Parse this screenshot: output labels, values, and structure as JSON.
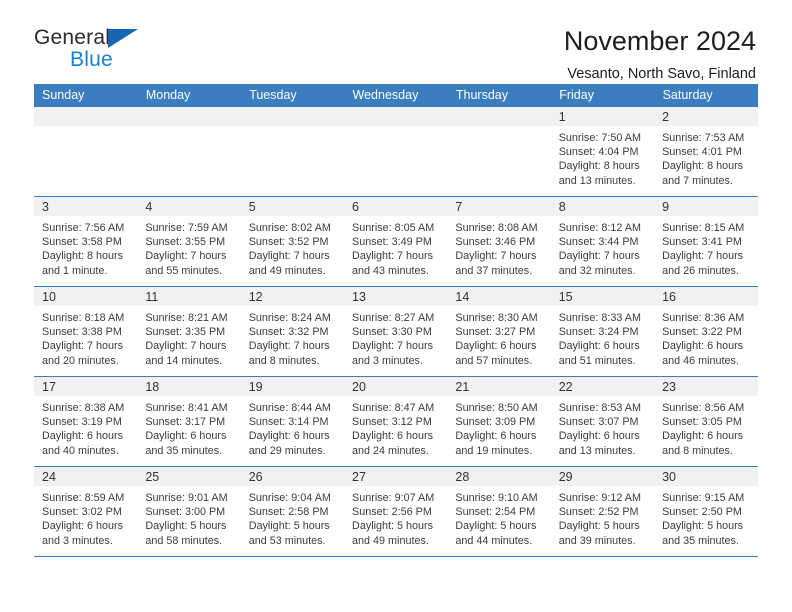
{
  "brand": {
    "word_one": "General",
    "word_two": "Blue",
    "triangle_icon": "triangle-icon",
    "accent_color": "#1667b2",
    "blue_color": "#1a7ed1"
  },
  "header": {
    "title": "November 2024",
    "subtitle": "Vesanto, North Savo, Finland"
  },
  "theme": {
    "header_blue": "#3a7ec0",
    "daynum_band": "#f1f1f1",
    "text": "#3c3c3c"
  },
  "weekdays": [
    "Sunday",
    "Monday",
    "Tuesday",
    "Wednesday",
    "Thursday",
    "Friday",
    "Saturday"
  ],
  "weeks": [
    [
      {
        "day": "",
        "sunrise": "",
        "sunset": "",
        "daylight_1": "",
        "daylight_2": ""
      },
      {
        "day": "",
        "sunrise": "",
        "sunset": "",
        "daylight_1": "",
        "daylight_2": ""
      },
      {
        "day": "",
        "sunrise": "",
        "sunset": "",
        "daylight_1": "",
        "daylight_2": ""
      },
      {
        "day": "",
        "sunrise": "",
        "sunset": "",
        "daylight_1": "",
        "daylight_2": ""
      },
      {
        "day": "",
        "sunrise": "",
        "sunset": "",
        "daylight_1": "",
        "daylight_2": ""
      },
      {
        "day": "1",
        "sunrise": "Sunrise: 7:50 AM",
        "sunset": "Sunset: 4:04 PM",
        "daylight_1": "Daylight: 8 hours",
        "daylight_2": "and 13 minutes."
      },
      {
        "day": "2",
        "sunrise": "Sunrise: 7:53 AM",
        "sunset": "Sunset: 4:01 PM",
        "daylight_1": "Daylight: 8 hours",
        "daylight_2": "and 7 minutes."
      }
    ],
    [
      {
        "day": "3",
        "sunrise": "Sunrise: 7:56 AM",
        "sunset": "Sunset: 3:58 PM",
        "daylight_1": "Daylight: 8 hours",
        "daylight_2": "and 1 minute."
      },
      {
        "day": "4",
        "sunrise": "Sunrise: 7:59 AM",
        "sunset": "Sunset: 3:55 PM",
        "daylight_1": "Daylight: 7 hours",
        "daylight_2": "and 55 minutes."
      },
      {
        "day": "5",
        "sunrise": "Sunrise: 8:02 AM",
        "sunset": "Sunset: 3:52 PM",
        "daylight_1": "Daylight: 7 hours",
        "daylight_2": "and 49 minutes."
      },
      {
        "day": "6",
        "sunrise": "Sunrise: 8:05 AM",
        "sunset": "Sunset: 3:49 PM",
        "daylight_1": "Daylight: 7 hours",
        "daylight_2": "and 43 minutes."
      },
      {
        "day": "7",
        "sunrise": "Sunrise: 8:08 AM",
        "sunset": "Sunset: 3:46 PM",
        "daylight_1": "Daylight: 7 hours",
        "daylight_2": "and 37 minutes."
      },
      {
        "day": "8",
        "sunrise": "Sunrise: 8:12 AM",
        "sunset": "Sunset: 3:44 PM",
        "daylight_1": "Daylight: 7 hours",
        "daylight_2": "and 32 minutes."
      },
      {
        "day": "9",
        "sunrise": "Sunrise: 8:15 AM",
        "sunset": "Sunset: 3:41 PM",
        "daylight_1": "Daylight: 7 hours",
        "daylight_2": "and 26 minutes."
      }
    ],
    [
      {
        "day": "10",
        "sunrise": "Sunrise: 8:18 AM",
        "sunset": "Sunset: 3:38 PM",
        "daylight_1": "Daylight: 7 hours",
        "daylight_2": "and 20 minutes."
      },
      {
        "day": "11",
        "sunrise": "Sunrise: 8:21 AM",
        "sunset": "Sunset: 3:35 PM",
        "daylight_1": "Daylight: 7 hours",
        "daylight_2": "and 14 minutes."
      },
      {
        "day": "12",
        "sunrise": "Sunrise: 8:24 AM",
        "sunset": "Sunset: 3:32 PM",
        "daylight_1": "Daylight: 7 hours",
        "daylight_2": "and 8 minutes."
      },
      {
        "day": "13",
        "sunrise": "Sunrise: 8:27 AM",
        "sunset": "Sunset: 3:30 PM",
        "daylight_1": "Daylight: 7 hours",
        "daylight_2": "and 3 minutes."
      },
      {
        "day": "14",
        "sunrise": "Sunrise: 8:30 AM",
        "sunset": "Sunset: 3:27 PM",
        "daylight_1": "Daylight: 6 hours",
        "daylight_2": "and 57 minutes."
      },
      {
        "day": "15",
        "sunrise": "Sunrise: 8:33 AM",
        "sunset": "Sunset: 3:24 PM",
        "daylight_1": "Daylight: 6 hours",
        "daylight_2": "and 51 minutes."
      },
      {
        "day": "16",
        "sunrise": "Sunrise: 8:36 AM",
        "sunset": "Sunset: 3:22 PM",
        "daylight_1": "Daylight: 6 hours",
        "daylight_2": "and 46 minutes."
      }
    ],
    [
      {
        "day": "17",
        "sunrise": "Sunrise: 8:38 AM",
        "sunset": "Sunset: 3:19 PM",
        "daylight_1": "Daylight: 6 hours",
        "daylight_2": "and 40 minutes."
      },
      {
        "day": "18",
        "sunrise": "Sunrise: 8:41 AM",
        "sunset": "Sunset: 3:17 PM",
        "daylight_1": "Daylight: 6 hours",
        "daylight_2": "and 35 minutes."
      },
      {
        "day": "19",
        "sunrise": "Sunrise: 8:44 AM",
        "sunset": "Sunset: 3:14 PM",
        "daylight_1": "Daylight: 6 hours",
        "daylight_2": "and 29 minutes."
      },
      {
        "day": "20",
        "sunrise": "Sunrise: 8:47 AM",
        "sunset": "Sunset: 3:12 PM",
        "daylight_1": "Daylight: 6 hours",
        "daylight_2": "and 24 minutes."
      },
      {
        "day": "21",
        "sunrise": "Sunrise: 8:50 AM",
        "sunset": "Sunset: 3:09 PM",
        "daylight_1": "Daylight: 6 hours",
        "daylight_2": "and 19 minutes."
      },
      {
        "day": "22",
        "sunrise": "Sunrise: 8:53 AM",
        "sunset": "Sunset: 3:07 PM",
        "daylight_1": "Daylight: 6 hours",
        "daylight_2": "and 13 minutes."
      },
      {
        "day": "23",
        "sunrise": "Sunrise: 8:56 AM",
        "sunset": "Sunset: 3:05 PM",
        "daylight_1": "Daylight: 6 hours",
        "daylight_2": "and 8 minutes."
      }
    ],
    [
      {
        "day": "24",
        "sunrise": "Sunrise: 8:59 AM",
        "sunset": "Sunset: 3:02 PM",
        "daylight_1": "Daylight: 6 hours",
        "daylight_2": "and 3 minutes."
      },
      {
        "day": "25",
        "sunrise": "Sunrise: 9:01 AM",
        "sunset": "Sunset: 3:00 PM",
        "daylight_1": "Daylight: 5 hours",
        "daylight_2": "and 58 minutes."
      },
      {
        "day": "26",
        "sunrise": "Sunrise: 9:04 AM",
        "sunset": "Sunset: 2:58 PM",
        "daylight_1": "Daylight: 5 hours",
        "daylight_2": "and 53 minutes."
      },
      {
        "day": "27",
        "sunrise": "Sunrise: 9:07 AM",
        "sunset": "Sunset: 2:56 PM",
        "daylight_1": "Daylight: 5 hours",
        "daylight_2": "and 49 minutes."
      },
      {
        "day": "28",
        "sunrise": "Sunrise: 9:10 AM",
        "sunset": "Sunset: 2:54 PM",
        "daylight_1": "Daylight: 5 hours",
        "daylight_2": "and 44 minutes."
      },
      {
        "day": "29",
        "sunrise": "Sunrise: 9:12 AM",
        "sunset": "Sunset: 2:52 PM",
        "daylight_1": "Daylight: 5 hours",
        "daylight_2": "and 39 minutes."
      },
      {
        "day": "30",
        "sunrise": "Sunrise: 9:15 AM",
        "sunset": "Sunset: 2:50 PM",
        "daylight_1": "Daylight: 5 hours",
        "daylight_2": "and 35 minutes."
      }
    ]
  ]
}
